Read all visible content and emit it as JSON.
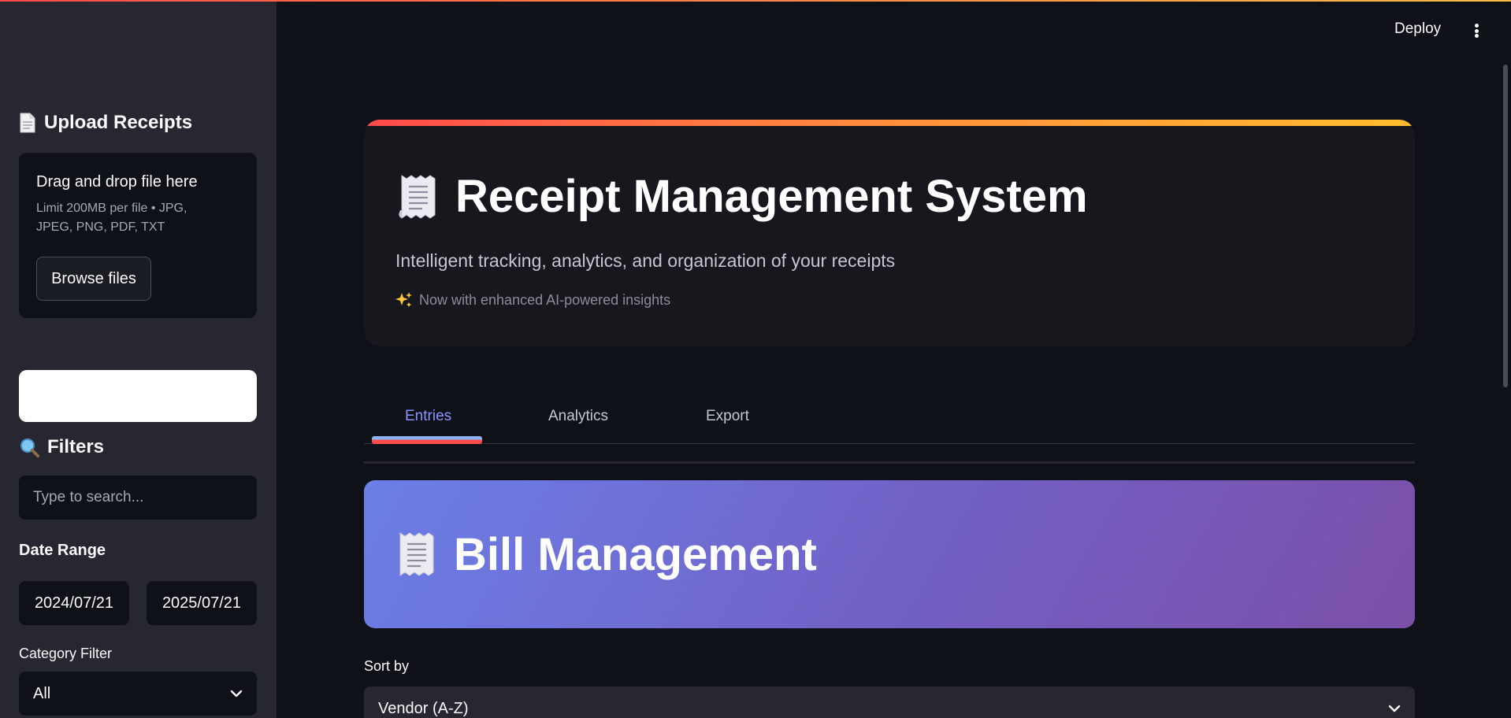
{
  "sidebar": {
    "upload_heading": "Upload Receipts",
    "uploader": {
      "title": "Drag and drop file here",
      "limit": "Limit 200MB per file • JPG, JPEG, PNG, PDF, TXT",
      "browse_label": "Browse files"
    },
    "filters_heading": "Filters",
    "search_placeholder": "Type to search...",
    "date_range_label": "Date Range",
    "date_start": "2024/07/21",
    "date_end": "2025/07/21",
    "category_label": "Category Filter",
    "category_value": "All"
  },
  "header": {
    "deploy_label": "Deploy"
  },
  "hero": {
    "title": "Receipt Management System",
    "subtitle": "Intelligent tracking, analytics, and organization of your receipts",
    "note": "Now with enhanced AI-powered insights"
  },
  "tabs": [
    {
      "label": "Entries",
      "active": true
    },
    {
      "label": "Analytics",
      "active": false
    },
    {
      "label": "Export",
      "active": false
    }
  ],
  "banner": {
    "title": "Bill Management"
  },
  "sort": {
    "label": "Sort by",
    "value": "Vendor (A-Z)"
  },
  "colors": {
    "accent": "#ff4b4b",
    "tab_active": "#8a94ff",
    "banner_start": "#6b7fe6",
    "banner_end": "#7b4fa8"
  }
}
